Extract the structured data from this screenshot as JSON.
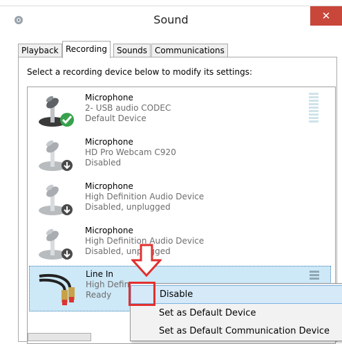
{
  "window": {
    "title": "Sound",
    "close_label": "✕"
  },
  "tabs": [
    {
      "label": "Playback",
      "active": false
    },
    {
      "label": "Recording",
      "active": true
    },
    {
      "label": "Sounds",
      "active": false
    },
    {
      "label": "Communications",
      "active": false
    }
  ],
  "instruction": "Select a recording device below to modify its settings:",
  "devices": [
    {
      "name": "Microphone",
      "driver": "2- USB audio CODEC",
      "status": "Default Device",
      "badge": "default-check"
    },
    {
      "name": "Microphone",
      "driver": "HD Pro Webcam C920",
      "status": "Disabled",
      "badge": "disabled-arrow"
    },
    {
      "name": "Microphone",
      "driver": "High Definition Audio Device",
      "status": "Disabled, unplugged",
      "badge": "disabled-arrow"
    },
    {
      "name": "Microphone",
      "driver": "High Definition Audio Device",
      "status": "Disabled, unplugged",
      "badge": "disabled-arrow"
    },
    {
      "name": "Line In",
      "driver": "High Defin",
      "status": "Ready",
      "badge": "none"
    }
  ],
  "context_menu": {
    "items": [
      "Disable",
      "Set as Default Device",
      "Set as Default Communication Device"
    ],
    "highlighted": "Disable"
  },
  "colors": {
    "close_bg": "#c9473a",
    "annotation": "#e0302f",
    "selection": "#cde8f7",
    "highlight": "#d5e9f8"
  }
}
